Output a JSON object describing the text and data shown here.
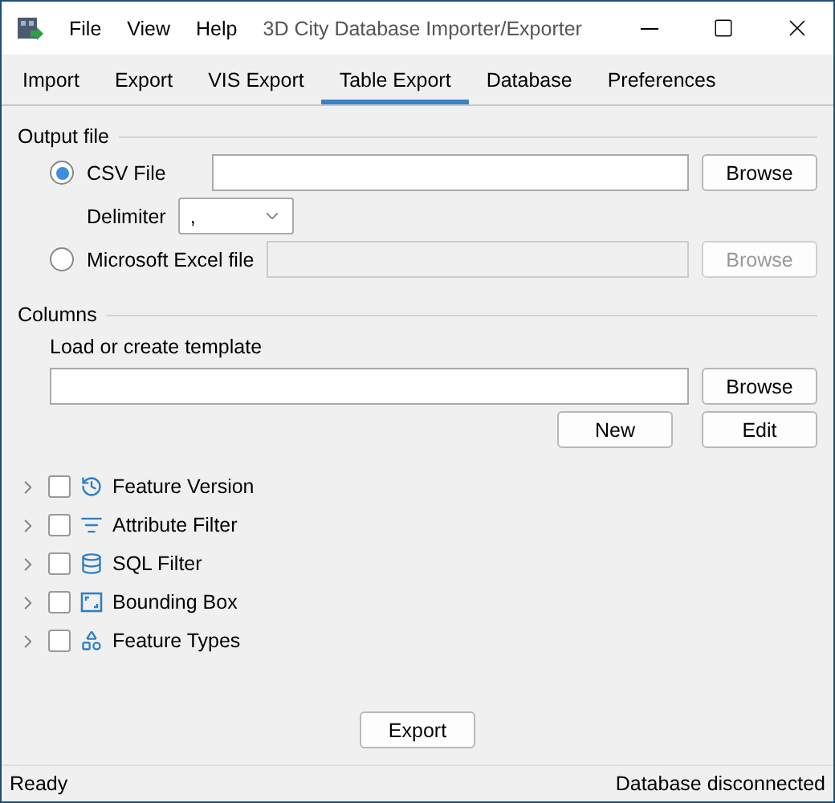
{
  "window": {
    "title": "3D City Database Importer/Exporter"
  },
  "menu": [
    "File",
    "View",
    "Help"
  ],
  "tabs": [
    {
      "label": "Import",
      "selected": false
    },
    {
      "label": "Export",
      "selected": false
    },
    {
      "label": "VIS Export",
      "selected": false
    },
    {
      "label": "Table Export",
      "selected": true
    },
    {
      "label": "Database",
      "selected": false
    },
    {
      "label": "Preferences",
      "selected": false
    }
  ],
  "output_file": {
    "title": "Output file",
    "csv": {
      "label": "CSV File",
      "selected": true,
      "button": "Browse",
      "button_disabled": false
    },
    "delimiter": {
      "label": "Delimiter",
      "value": ","
    },
    "excel": {
      "label": "Microsoft Excel file",
      "selected": false,
      "button": "Browse",
      "button_disabled": true
    }
  },
  "columns": {
    "title": "Columns",
    "template_label": "Load or create template",
    "browse": "Browse",
    "new": "New",
    "edit": "Edit"
  },
  "options": [
    {
      "label": "Feature Version",
      "kind": "version",
      "checked": false,
      "expanded": false
    },
    {
      "label": "Attribute Filter",
      "kind": "filter",
      "checked": false,
      "expanded": false
    },
    {
      "label": "SQL Filter",
      "kind": "sql",
      "checked": false,
      "expanded": false
    },
    {
      "label": "Bounding Box",
      "kind": "bbox",
      "checked": false,
      "expanded": false
    },
    {
      "label": "Feature Types",
      "kind": "types",
      "checked": false,
      "expanded": false
    }
  ],
  "export_button": "Export",
  "status_bar": {
    "left": "Ready",
    "right": "Database disconnected"
  }
}
